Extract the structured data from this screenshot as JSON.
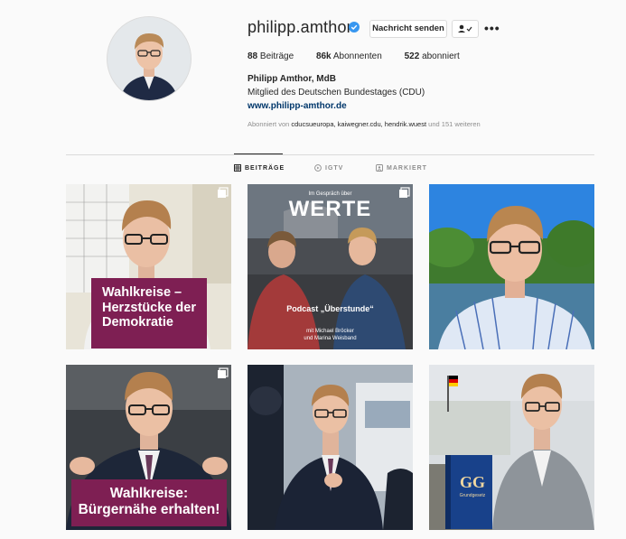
{
  "profile": {
    "username": "philipp.amthor",
    "message_button": "Nachricht senden",
    "more": "•••",
    "stats": {
      "posts_count": "88",
      "posts_label": "Beiträge",
      "followers_count": "86k",
      "followers_label": "Abonnenten",
      "following_count": "522",
      "following_label": "abonniert"
    },
    "full_name": "Philipp Amthor, MdB",
    "bio": "Mitglied des Deutschen Bundestages (CDU)",
    "website": "www.philipp-amthor.de",
    "followed_by_prefix": "Abonniert von",
    "followed_by_names": "cducsueuropa, kaiwegner.cdu, hendrik.wuest",
    "followed_by_suffix": "und 151 weiteren"
  },
  "tabs": [
    {
      "label": "BEITRÄGE",
      "icon": "grid-icon"
    },
    {
      "label": "IGTV",
      "icon": "igtv-icon"
    },
    {
      "label": "MARKIERT",
      "icon": "tagged-icon"
    }
  ],
  "posts": [
    {
      "caption": "Wahlkreise –\nHerzstücke der\nDemokratie",
      "type": "carousel"
    },
    {
      "top_small": "Im Gespräch über",
      "top_big": "WERTE",
      "caption": "Podcast „Überstunde“",
      "subcaption1": "mit Michael Bröcker",
      "subcaption2": "und Marina Weisband",
      "type": "carousel"
    },
    {
      "type": "photo"
    },
    {
      "caption": "Wahlkreise:\nBürgernähe erhalten!",
      "type": "carousel"
    },
    {
      "type": "photo"
    },
    {
      "book_title": "GG",
      "book_sub": "Grundgesetz",
      "type": "photo"
    }
  ]
}
